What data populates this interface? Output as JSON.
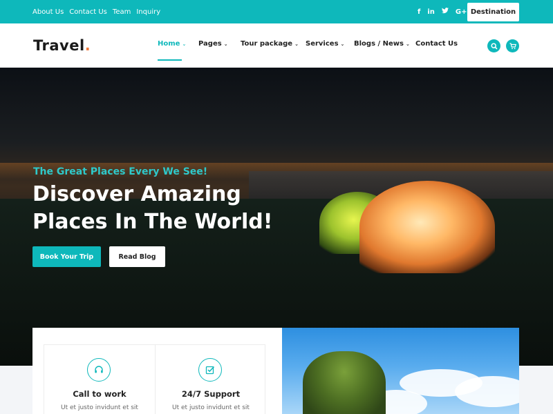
{
  "topbar": {
    "links": [
      "About Us",
      "Contact Us",
      "Team",
      "Inquiry"
    ],
    "social": [
      {
        "icon": "facebook-icon",
        "glyph": "f"
      },
      {
        "icon": "linkedin-icon",
        "glyph": "in"
      },
      {
        "icon": "twitter-icon",
        "glyph": "t"
      },
      {
        "icon": "google-plus-icon",
        "glyph": "G+"
      }
    ],
    "destination_label": "Destination"
  },
  "header": {
    "logo": "Travel",
    "logo_dot": ".",
    "nav": [
      {
        "label": "Home",
        "active": true
      },
      {
        "label": "Pages",
        "active": false
      },
      {
        "label": "Tour package",
        "active": false
      },
      {
        "label": "Services",
        "active": false
      },
      {
        "label": "Blogs / News",
        "active": false
      },
      {
        "label": "Contact Us",
        "active": false
      }
    ],
    "icons": [
      "search-icon",
      "cart-icon"
    ]
  },
  "hero": {
    "subtitle": "The Great Places Every We See!",
    "title_line1": "Discover Amazing",
    "title_line2": "Places In The World!",
    "book_button": "Book Your Trip",
    "blog_button": "Read Blog"
  },
  "features": [
    {
      "icon": "headphones-icon",
      "title": "Call to work",
      "text": "Ut et justo invidunt et sit"
    },
    {
      "icon": "checkbox-icon",
      "title": "24/7 Support",
      "text": "Ut et justo invidunt et sit"
    }
  ],
  "colors": {
    "accent": "#0eb8bb",
    "logo_dot": "#f07b3f"
  }
}
